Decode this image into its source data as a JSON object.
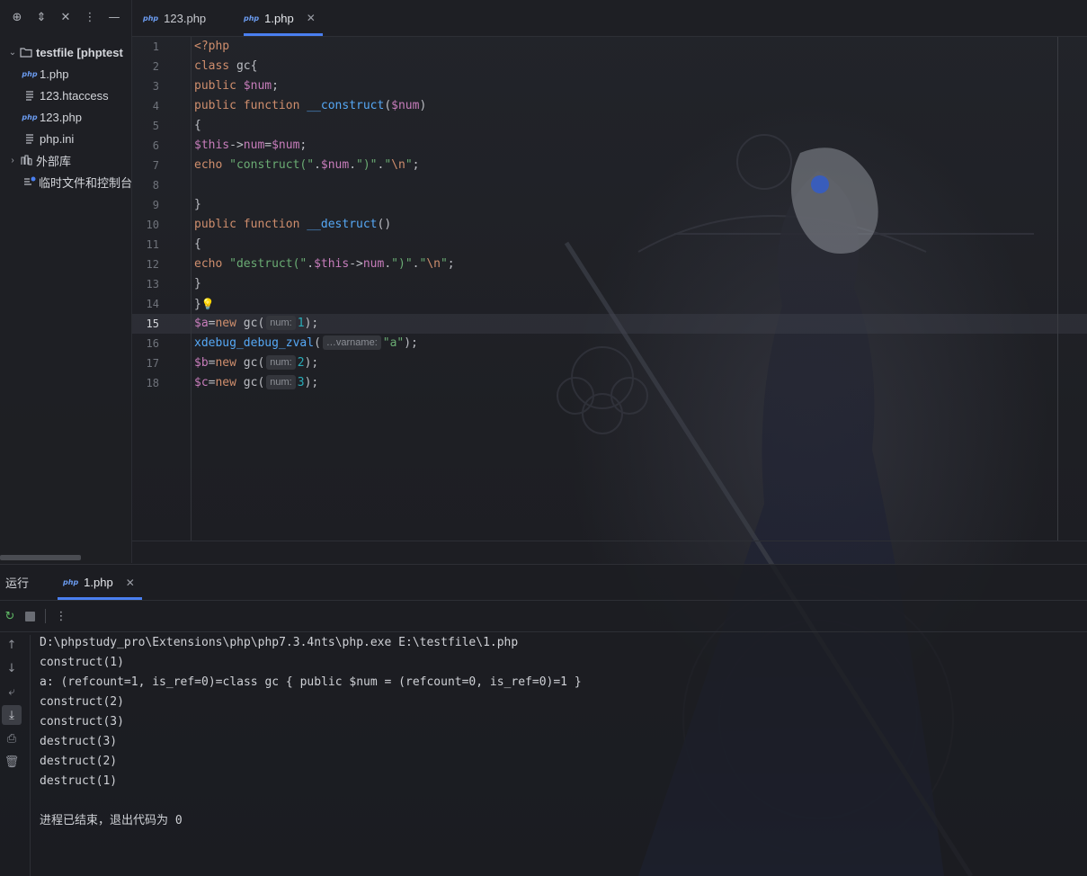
{
  "project_toolbar": {
    "icons": [
      "locate-icon",
      "expand-collapse-icon",
      "collapse-all-icon",
      "more-options-icon",
      "minimize-icon"
    ]
  },
  "tree": {
    "root_label": "testfile [phptest",
    "items": [
      {
        "label": "1.php",
        "icon": "php-file-icon"
      },
      {
        "label": "123.htaccess",
        "icon": "text-file-icon"
      },
      {
        "label": "123.php",
        "icon": "php-file-icon"
      },
      {
        "label": "php.ini",
        "icon": "text-file-icon"
      }
    ],
    "external_libs": "外部库",
    "scratches": "临时文件和控制台"
  },
  "editor_tabs": [
    {
      "label": "123.php",
      "icon_text": "php"
    },
    {
      "label": "1.php",
      "icon_text": "php",
      "active": true
    }
  ],
  "code": {
    "current_line": 15,
    "line_numbers": [
      "1",
      "2",
      "3",
      "4",
      "5",
      "6",
      "7",
      "8",
      "9",
      "10",
      "11",
      "12",
      "13",
      "14",
      "15",
      "16",
      "17",
      "18"
    ],
    "hints": {
      "num": "num:",
      "varname": "…varname:"
    }
  },
  "run_panel": {
    "title": "运行",
    "tab_label": "1.php",
    "console_lines": [
      "D:\\phpstudy_pro\\Extensions\\php\\php7.3.4nts\\php.exe E:\\testfile\\1.php",
      "construct(1)",
      "a: (refcount=1, is_ref=0)=class gc { public $num = (refcount=0, is_ref=0)=1 }",
      "construct(2)",
      "construct(3)",
      "destruct(3)",
      "destruct(2)",
      "destruct(1)",
      "",
      "进程已结束，退出代码为 0"
    ]
  },
  "colors": {
    "accent": "#4a7ff0",
    "keyword": "#cf8e6d",
    "variable": "#c77dbb",
    "function": "#56a8f5",
    "string": "#6aab73",
    "number": "#2aacb8"
  }
}
